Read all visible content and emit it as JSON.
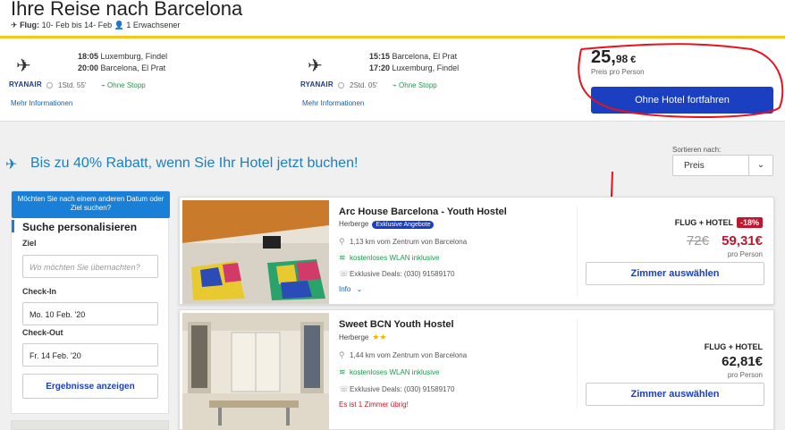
{
  "header": {
    "title": "Ihre Reise nach Barcelona",
    "flight_prefix": "Flug:",
    "flight_dates": "10- Feb bis 14- Feb",
    "travelers": "1 Erwachsener"
  },
  "flights": [
    {
      "airline": "RYANAIR",
      "dep_time": "18:05",
      "dep_place": "Luxemburg, Findel",
      "arr_time": "20:00",
      "arr_place": "Barcelona, El Prat",
      "duration": "1Std. 55'",
      "stops": "Ohne Stopp",
      "more": "Mehr Informationen"
    },
    {
      "airline": "RYANAIR",
      "dep_time": "15:15",
      "dep_place": "Barcelona, El Prat",
      "arr_time": "17:20",
      "arr_place": "Luxemburg, Findel",
      "duration": "2Std. 05'",
      "stops": "Ohne Stopp",
      "more": "Mehr Informationen"
    }
  ],
  "price": {
    "main": "25,",
    "cents": "98",
    "currency": "€",
    "label": "Preis pro Person",
    "button": "Ohne Hotel fortfahren"
  },
  "promo": {
    "text": "Bis zu 40% Rabatt, wenn Sie Ihr Hotel jetzt buchen!"
  },
  "sort": {
    "label": "Sortieren nach:",
    "value": "Preis"
  },
  "sidebar": {
    "tip": "Möchten Sie nach einem anderen Datum oder Ziel suchen?",
    "title": "Suche personalisieren",
    "ziel_label": "Ziel",
    "ziel_placeholder": "Wo möchten Sie übernachten?",
    "checkin_label": "Check-In",
    "checkin_value": "Mo. 10 Feb. '20",
    "checkout_label": "Check-Out",
    "checkout_value": "Fr. 14 Feb. '20",
    "button": "Ergebnisse anzeigen"
  },
  "hotels": [
    {
      "name": "Arc House Barcelona - Youth Hostel",
      "type": "Herberge",
      "badge": "Exklusive Angebote",
      "distance": "1,13 km vom Zentrum von Barcelona",
      "wifi": "kostenloses WLAN inklusive",
      "deals": "Exklusive Deals: (030) 91589170",
      "info": "Info",
      "flug_hotel": "FLUG + HOTEL",
      "discount": "-18%",
      "old_price": "72€",
      "price": "59,31€",
      "per_person": "pro Person",
      "button": "Zimmer auswählen"
    },
    {
      "name": "Sweet BCN Youth Hostel",
      "type": "Herberge",
      "stars": "★★",
      "distance": "1,44 km vom Zentrum von Barcelona",
      "wifi": "kostenloses WLAN inklusive",
      "deals": "Exklusive Deals: (030) 91589170",
      "warning": "Es ist 1 Zimmer übrig!",
      "flug_hotel": "FLUG + HOTEL",
      "price": "62,81€",
      "per_person": "pro Person",
      "button": "Zimmer auswählen"
    }
  ],
  "colors": {
    "accent": "#1a3fc1",
    "promo": "#1a7fc1",
    "sale": "#c0162e",
    "annotation": "#e8121c"
  }
}
